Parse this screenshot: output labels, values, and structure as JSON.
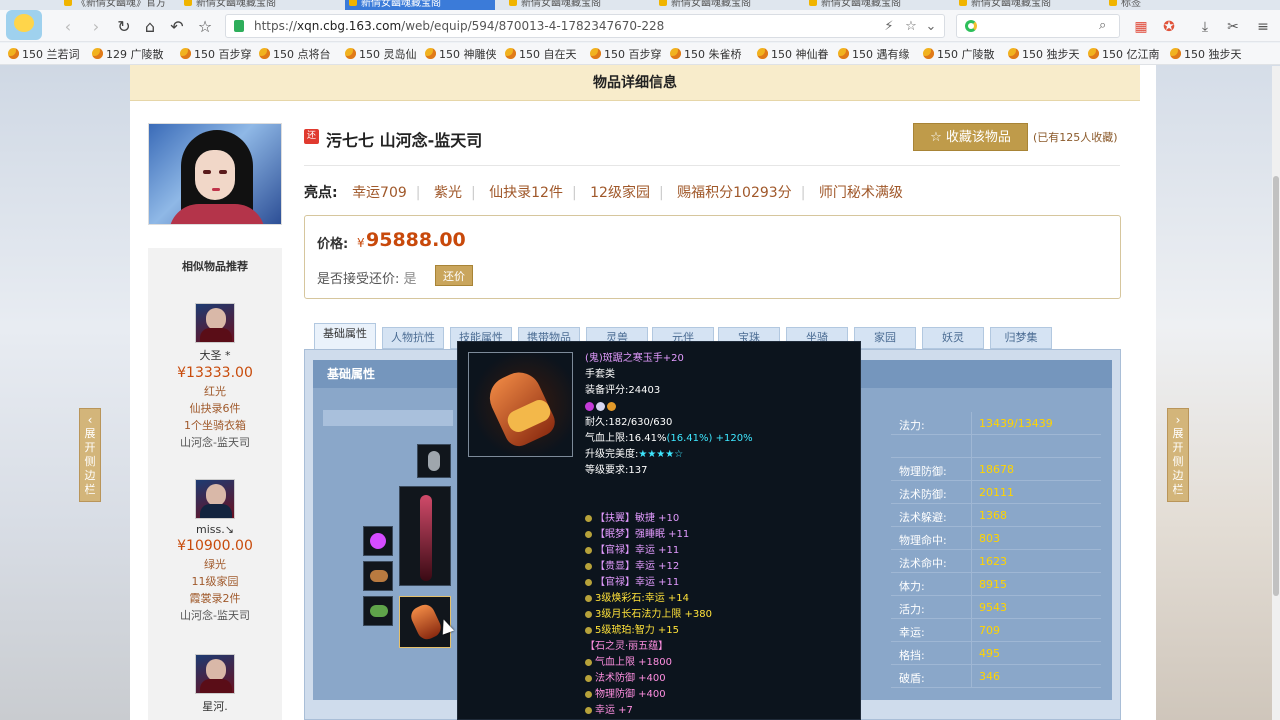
{
  "browser": {
    "tabs": [
      {
        "label": "《新倩女幽魂》官方"
      },
      {
        "label": "新倩女幽魂藏宝阁"
      },
      {
        "label": "新倩女幽魂藏宝阁"
      },
      {
        "label": "新倩女幽魂藏宝阁"
      },
      {
        "label": "新倩女幽魂藏宝阁"
      },
      {
        "label": "新倩女幽魂藏宝阁"
      },
      {
        "label": "新倩女幽魂藏宝阁"
      },
      {
        "label": "标签"
      }
    ],
    "url": {
      "scheme": "https://",
      "host": "xqn.cbg.163.com",
      "path": "/web/equip/594/870013-4-1782347670-228"
    },
    "bookmarks": [
      "150 兰若词",
      "129 广陵散",
      "150 百步穿",
      "150 点将台",
      "150 灵岛仙",
      "150 神雕侠",
      "150 自在天",
      "150 百步穿",
      "150 朱雀桥",
      "150 神仙眷",
      "150 遇有缘",
      "150 广陵散",
      "150 独步天",
      "150 亿江南",
      "150 独步天"
    ]
  },
  "page": {
    "title": "物品详细信息",
    "side_tab_left": [
      "展",
      "开",
      "侧",
      "边",
      "栏"
    ],
    "side_tab_right": [
      "展",
      "开",
      "侧",
      "边",
      "栏"
    ]
  },
  "character": {
    "badge": "还",
    "name": "污七七  山河念-监天司",
    "favorite_button": "收藏该物品",
    "favorite_count": "(已有125人收藏)",
    "highlights_label": "亮点:",
    "highlights": [
      "幸运709",
      "紫光",
      "仙抉录12件",
      "12级家园",
      "赐福积分10293分",
      "师门秘术满级"
    ]
  },
  "price": {
    "label": "价格:",
    "currency": "¥",
    "value": "95888.00",
    "bargain_label": "是否接受还价:",
    "bargain_value": "是",
    "bargain_button": "还价"
  },
  "similar": {
    "title": "相似物品推荐",
    "items": [
      {
        "name": "大圣 *",
        "price": "¥13333.00",
        "lines": [
          "红光",
          "仙抉录6件",
          "1个坐骑衣箱"
        ],
        "server": "山河念-监天司"
      },
      {
        "name": "miss.↘",
        "price": "¥10900.00",
        "lines": [
          "绿光",
          "11级家园",
          "霞裳录2件"
        ],
        "server": "山河念-监天司"
      },
      {
        "name": "星河.",
        "price": "",
        "lines": [],
        "server": ""
      }
    ]
  },
  "tabs": [
    "基础属性",
    "人物抗性",
    "技能属性",
    "携带物品",
    "灵兽",
    "元伴",
    "宝珠",
    "坐骑",
    "家园",
    "妖灵",
    "归梦集"
  ],
  "panel": {
    "title": "基础属性"
  },
  "stats": [
    {
      "key": "法力:",
      "value": "13439/13439"
    },
    {
      "key": "",
      "value": ""
    },
    {
      "key": "物理防御:",
      "value": "18678"
    },
    {
      "key": "法术防御:",
      "value": "20111"
    },
    {
      "key": "法术躲避:",
      "value": "1368"
    },
    {
      "key": "物理命中:",
      "value": "803"
    },
    {
      "key": "法术命中:",
      "value": "1623"
    },
    {
      "key": "体力:",
      "value": "8915"
    },
    {
      "key": "活力:",
      "value": "9543"
    },
    {
      "key": "幸运:",
      "value": "709"
    },
    {
      "key": "格挡:",
      "value": "495"
    },
    {
      "key": "破盾:",
      "value": "346"
    }
  ],
  "tooltip": {
    "name": "(鬼)斑踞之寒玉手+20",
    "type": "手套类",
    "score": "装备评分:24403",
    "durability": "耐久:182/630/630",
    "hp_bonus_prefix": "气血上限:16.41%",
    "hp_bonus_extra": "(16.41%) +120%",
    "perfection": "升级完美度:",
    "stars": "★★★★☆",
    "level": "等级要求:137",
    "attrs": [
      {
        "text": "【扶翼】敏捷 +10",
        "color": "c-pur"
      },
      {
        "text": "【眠梦】强睡眠 +11",
        "color": "c-pur"
      },
      {
        "text": "【官禄】幸运 +11",
        "color": "c-pur"
      },
      {
        "text": "【贵显】幸运 +12",
        "color": "c-pur"
      },
      {
        "text": "【官禄】幸运 +11",
        "color": "c-pur"
      },
      {
        "text": "3级焕彩石:幸运 +14",
        "color": "c-yl"
      },
      {
        "text": "3级月长石法力上限 +380",
        "color": "c-yl"
      },
      {
        "text": "5级琥珀:智力 +15",
        "color": "c-yl"
      }
    ],
    "set_name": "【石之灵·丽五蕴】",
    "set_attrs": [
      "气血上限 +1800",
      "法术防御 +400",
      "物理防御 +400",
      "幸运 +7"
    ]
  },
  "colors": {
    "accent": "#bf9b4a",
    "price": "#c8490b",
    "highlight": "#a0582a",
    "stat_value": "#ffd400"
  }
}
